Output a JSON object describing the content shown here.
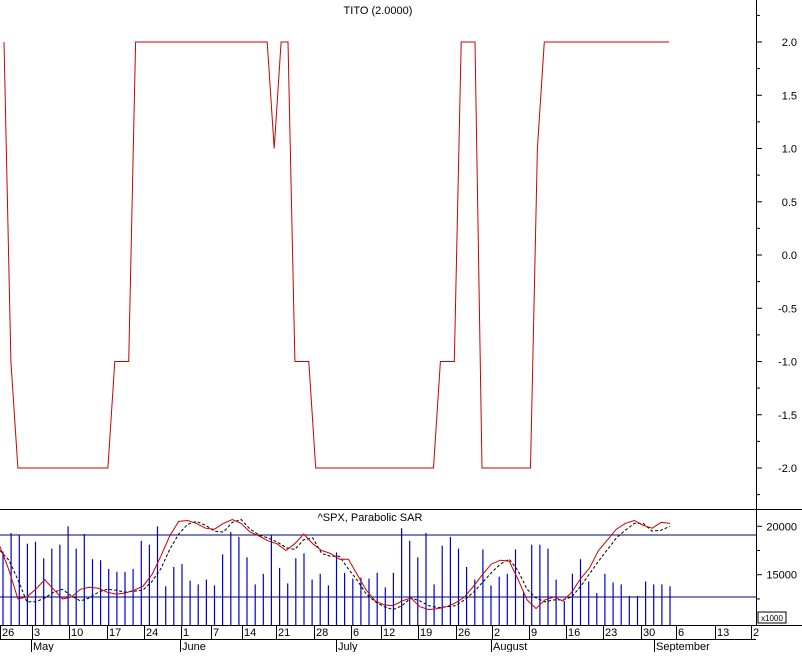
{
  "chart_data": [
    {
      "type": "line",
      "title": "TITO (2.0000)",
      "x": [
        0,
        1,
        2,
        3,
        4,
        5,
        6,
        7,
        8,
        9,
        10,
        11,
        12,
        13,
        14,
        15,
        16,
        17,
        18,
        19,
        20,
        21,
        22,
        23,
        24,
        25,
        26,
        27,
        28,
        29,
        30,
        31,
        32,
        33,
        34,
        35,
        36,
        37,
        38,
        39,
        40,
        41,
        42,
        43,
        44,
        45,
        46,
        47,
        48,
        49,
        50,
        51,
        52,
        53,
        54,
        55,
        56,
        57,
        58,
        59,
        60,
        61,
        62,
        63,
        64,
        65,
        66,
        67,
        68,
        69,
        70,
        71,
        72,
        73,
        74,
        75,
        76,
        77,
        78,
        79,
        80,
        81,
        82,
        83,
        84,
        85,
        86,
        87,
        88,
        89,
        90,
        91,
        92,
        93,
        94,
        95,
        96
      ],
      "series": [
        {
          "values": [
            2,
            -1,
            -2,
            -2,
            -2,
            -2,
            -2,
            -2,
            -2,
            -2,
            -2,
            -2,
            -2,
            -2,
            -2,
            -2,
            -1,
            -1,
            -1,
            2,
            2,
            2,
            2,
            2,
            2,
            2,
            2,
            2,
            2,
            2,
            2,
            2,
            2,
            2,
            2,
            2,
            2,
            2,
            2,
            1,
            2,
            2,
            -1,
            -1,
            -1,
            -2,
            -2,
            -2,
            -2,
            -2,
            -2,
            -2,
            -2,
            -2,
            -2,
            -2,
            -2,
            -2,
            -2,
            -2,
            -2,
            -2,
            -2,
            -1,
            -1,
            -1,
            2,
            2,
            2,
            -2,
            -2,
            -2,
            -2,
            -2,
            -2,
            -2,
            -2,
            1,
            2,
            2,
            2,
            2,
            2,
            2,
            2,
            2,
            2,
            2,
            2,
            2,
            2,
            2,
            2,
            2,
            2,
            2,
            2
          ],
          "color": "#cc0000"
        }
      ],
      "yticks": [
        "2.0",
        "1.5",
        "1.0",
        "0.5",
        "0.0",
        "-0.5",
        "-1.0",
        "-1.5",
        "-2.0"
      ],
      "ylim": [
        -2.4,
        2.4
      ]
    },
    {
      "type": "line",
      "title": "^SPX, Parabolic SAR",
      "unit_label": "x1000",
      "yticks": [
        "20000",
        "15000"
      ],
      "ylim": [
        10000,
        22500
      ],
      "hlines": [
        19100,
        12700
      ],
      "price": [
        17900,
        15500,
        12500,
        12700,
        13500,
        14500,
        13500,
        12500,
        12700,
        13500,
        13700,
        13600,
        13200,
        13000,
        13100,
        13400,
        13800,
        15000,
        16900,
        19000,
        20500,
        20600,
        20300,
        19800,
        19700,
        20300,
        20700,
        20300,
        19400,
        19000,
        18500,
        18200,
        17500,
        18200,
        19200,
        18200,
        17500,
        17200,
        16600,
        16600,
        15000,
        13400,
        12300,
        11900,
        11800,
        12300,
        12600,
        11700,
        11400,
        11500,
        11700,
        12100,
        12700,
        13800,
        15000,
        16100,
        16500,
        16400,
        14500,
        12400,
        11500,
        12400,
        12700,
        12300,
        13200,
        14600,
        15700,
        17500,
        18600,
        19700,
        20300,
        20600,
        20100,
        19800,
        20400,
        20300
      ],
      "sar": [
        17500,
        16500,
        14500,
        12200,
        12200,
        12600,
        13200,
        13500,
        12800,
        12300,
        12600,
        13200,
        13500,
        13400,
        13200,
        13300,
        13400,
        14300,
        15600,
        17600,
        19200,
        20200,
        20500,
        20100,
        19500,
        19400,
        20400,
        20700,
        19700,
        19100,
        18800,
        18400,
        17800,
        17600,
        18600,
        18800,
        17200,
        16900,
        16900,
        15600,
        14400,
        13000,
        12200,
        11700,
        11400,
        11800,
        12600,
        12300,
        11800,
        11600,
        11700,
        11800,
        12400,
        13200,
        14200,
        15200,
        16100,
        16600,
        15400,
        13500,
        12600,
        12200,
        12400,
        12400,
        12700,
        13800,
        15100,
        16400,
        17600,
        18800,
        19600,
        20300,
        20300,
        19500,
        19600,
        20000
      ],
      "volume": [
        17400,
        19300,
        19100,
        18200,
        18400,
        16700,
        17700,
        18100,
        20000,
        17700,
        19200,
        16600,
        16500,
        15600,
        15300,
        15300,
        15600,
        18500,
        18100,
        20000,
        13800,
        15800,
        16100,
        14400,
        14000,
        14500,
        13900,
        17100,
        19400,
        18900,
        16800,
        14000,
        15100,
        19100,
        15700,
        14100,
        16700,
        17200,
        14500,
        15100,
        13900,
        17300,
        15200,
        14600,
        14700,
        14600,
        15200,
        13700,
        15200,
        19800,
        18500,
        16800,
        19300,
        14000,
        18000,
        18900,
        17700,
        15800,
        14500,
        17600,
        13900,
        14800,
        15100,
        17600,
        13200,
        18100,
        18100,
        17700,
        14500,
        12300,
        15100,
        16600,
        14300,
        13100,
        15100,
        14200,
        14000,
        12800,
        12800,
        14300,
        14000,
        14000,
        13800
      ]
    }
  ],
  "x_axis": {
    "day_labels": [
      "26",
      "3",
      "10",
      "17",
      "24",
      "1",
      "7",
      "14",
      "21",
      "28",
      "6",
      "12",
      "19",
      "26",
      "2",
      "9",
      "16",
      "23",
      "30",
      "6",
      "13",
      "2"
    ],
    "month_labels": [
      "May",
      "June",
      "July",
      "August",
      "September"
    ]
  }
}
